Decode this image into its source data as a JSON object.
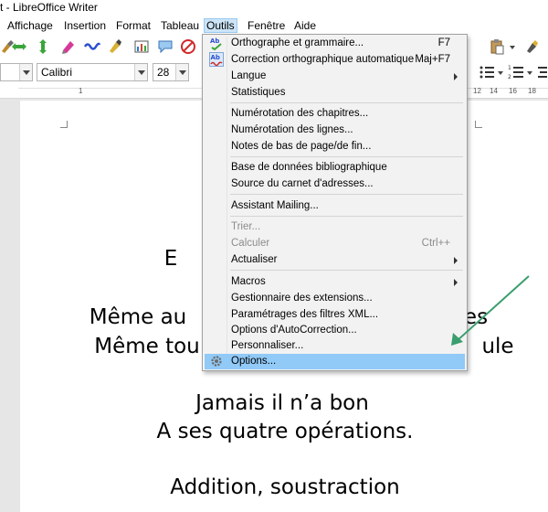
{
  "window": {
    "title": "t - LibreOffice Writer"
  },
  "menubar": {
    "items": [
      "Affichage",
      "Insertion",
      "Format",
      "Tableau",
      "Outils",
      "Fenêtre",
      "Aide"
    ]
  },
  "toolbar": {
    "font_name": "Calibri",
    "font_size": "28"
  },
  "ruler": {
    "numbers": [
      "1",
      "12",
      "14",
      "16",
      "18"
    ]
  },
  "document": {
    "lines": [
      "E",
      "Même au",
      "es",
      "Même tou",
      "ule",
      "Jamais il n’a bon",
      "A ses quatre opérations.",
      "Addition, soustraction"
    ]
  },
  "tools_menu": {
    "items": [
      {
        "label": "Orthographe et grammaire...",
        "shortcut": "F7"
      },
      {
        "label": "Correction orthographique automatique",
        "shortcut": "Maj+F7"
      },
      {
        "label": "Langue",
        "shortcut": ""
      },
      {
        "label": "Statistiques",
        "shortcut": ""
      },
      {
        "label": "Numérotation des chapitres...",
        "shortcut": ""
      },
      {
        "label": "Numérotation des lignes...",
        "shortcut": ""
      },
      {
        "label": "Notes de bas de page/de fin...",
        "shortcut": ""
      },
      {
        "label": "Base de données bibliographique",
        "shortcut": ""
      },
      {
        "label": "Source du carnet d'adresses...",
        "shortcut": ""
      },
      {
        "label": "Assistant Mailing...",
        "shortcut": ""
      },
      {
        "label": "Trier...",
        "shortcut": ""
      },
      {
        "label": "Calculer",
        "shortcut": "Ctrl++"
      },
      {
        "label": "Actualiser",
        "shortcut": ""
      },
      {
        "label": "Macros",
        "shortcut": ""
      },
      {
        "label": "Gestionnaire des extensions...",
        "shortcut": ""
      },
      {
        "label": "Paramétrages des filtres XML...",
        "shortcut": ""
      },
      {
        "label": "Options d'AutoCorrection...",
        "shortcut": ""
      },
      {
        "label": "Personnaliser...",
        "shortcut": ""
      },
      {
        "label": "Options...",
        "shortcut": ""
      }
    ]
  },
  "colors": {
    "menu_bg": "#f2f2f2",
    "highlight": "#91c9f7",
    "arrow": "#3a9e6e",
    "active_menu": "#cce4f7"
  }
}
